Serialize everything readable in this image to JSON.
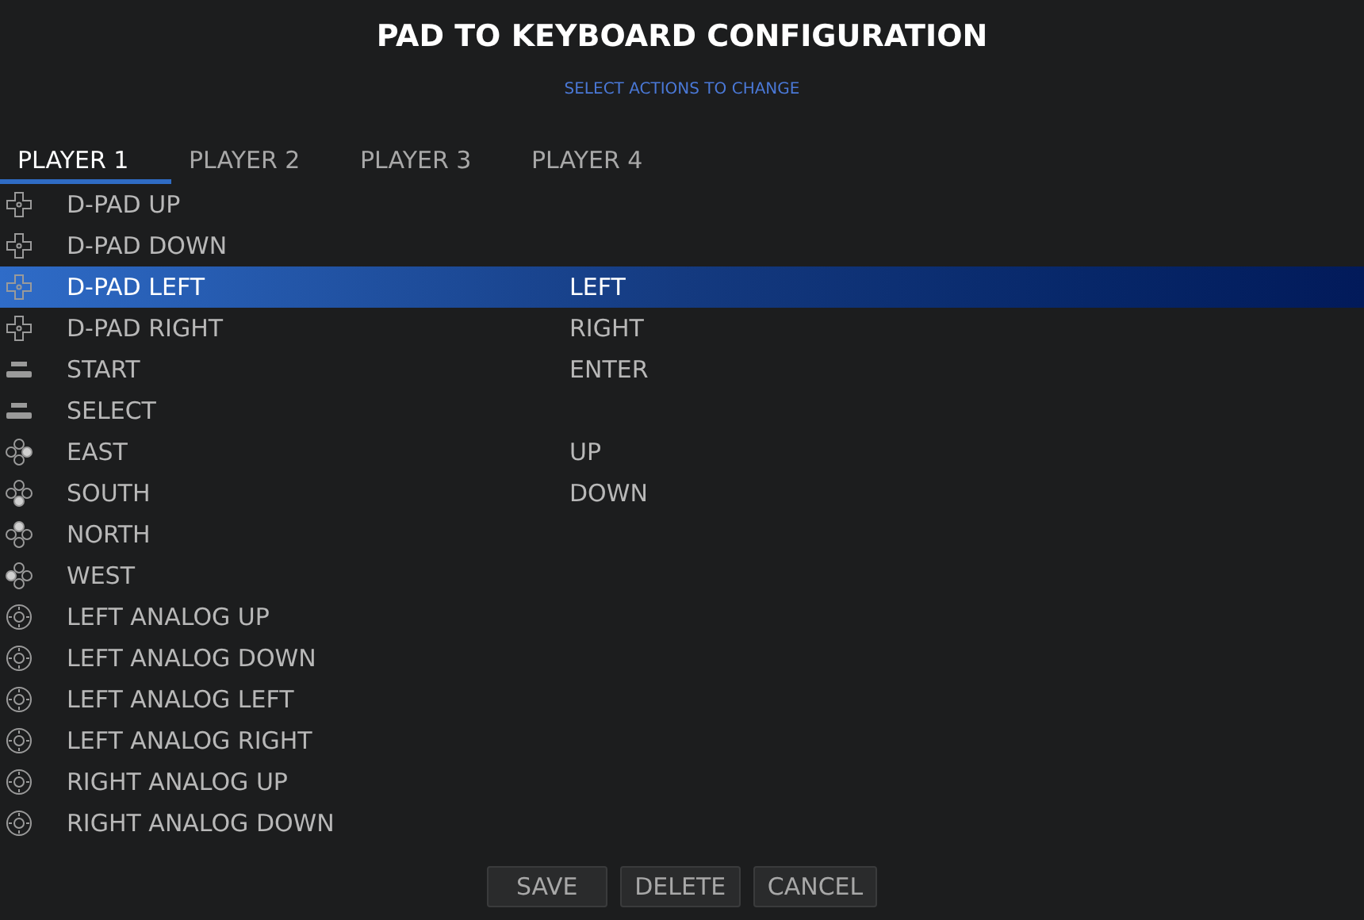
{
  "title": "PAD TO KEYBOARD CONFIGURATION",
  "subtitle": "SELECT ACTIONS TO CHANGE",
  "tabs": [
    {
      "label": "PLAYER 1",
      "selected": true
    },
    {
      "label": "PLAYER 2",
      "selected": false
    },
    {
      "label": "PLAYER 3",
      "selected": false
    },
    {
      "label": "PLAYER 4",
      "selected": false
    }
  ],
  "actions": [
    {
      "kind": "dpad",
      "name": "D-PAD UP",
      "selected": false
    },
    {
      "kind": "dpad",
      "name": "D-PAD DOWN",
      "selected": false
    },
    {
      "kind": "dpad",
      "name": "D-PAD LEFT",
      "key": "LEFT",
      "selected": true
    },
    {
      "kind": "dpad",
      "name": "D-PAD RIGHT",
      "key": "RIGHT",
      "selected": false
    },
    {
      "kind": "bar",
      "name": "START",
      "key": "ENTER",
      "selected": false
    },
    {
      "kind": "bar",
      "name": "SELECT",
      "selected": false
    },
    {
      "kind": "east",
      "name": "EAST",
      "key": "UP",
      "selected": false
    },
    {
      "kind": "south",
      "name": "SOUTH",
      "key": "DOWN",
      "selected": false
    },
    {
      "kind": "north",
      "name": "NORTH",
      "selected": false
    },
    {
      "kind": "west",
      "name": "WEST",
      "selected": false
    },
    {
      "kind": "analog",
      "name": "LEFT ANALOG UP",
      "selected": false
    },
    {
      "kind": "analog",
      "name": "LEFT ANALOG DOWN",
      "selected": false
    },
    {
      "kind": "analog",
      "name": "LEFT ANALOG LEFT",
      "selected": false
    },
    {
      "kind": "analog",
      "name": "LEFT ANALOG RIGHT",
      "selected": false
    },
    {
      "kind": "analog",
      "name": "RIGHT ANALOG UP",
      "selected": false
    },
    {
      "kind": "analog",
      "name": "RIGHT ANALOG DOWN",
      "selected": false
    }
  ],
  "buttons": [
    "SAVE",
    "DELETE",
    "CANCEL"
  ]
}
